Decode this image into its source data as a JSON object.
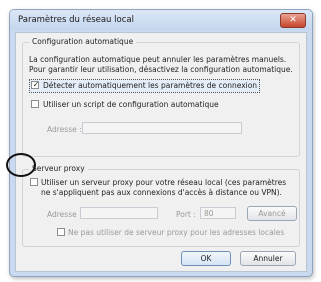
{
  "window": {
    "title": "Paramètres du réseau local",
    "close_glyph": "✕"
  },
  "auto_config": {
    "legend": "Configuration automatique",
    "description_line1": "La configuration automatique peut annuler les paramètres manuels.",
    "description_line2": "Pour garantir leur utilisation, désactivez la configuration automatique.",
    "detect_label": "Détecter automatiquement les paramètres de connexion",
    "detect_checked": true,
    "script_label": "Utiliser un script de configuration automatique",
    "script_checked": false,
    "address_label": "Adresse :",
    "address_value": ""
  },
  "proxy": {
    "legend": "Serveur proxy",
    "use_proxy_label_line1": "Utiliser un serveur proxy pour votre réseau local (ces paramètres",
    "use_proxy_label_line2": "ne s'appliquent pas aux connexions d'accès à distance ou VPN).",
    "use_proxy_checked": false,
    "address_label": "Adresse :",
    "address_value": "",
    "port_label": "Port :",
    "port_value": "80",
    "advanced_label": "Avancé",
    "bypass_label": "Ne pas utiliser de serveur proxy pour les adresses locales",
    "bypass_checked": false
  },
  "buttons": {
    "ok": "OK",
    "cancel": "Annuler"
  },
  "icons": {
    "checkmark": "✓"
  },
  "colors": {
    "title_bar": "#c4d6ee",
    "close_button": "#c7442c",
    "annotation": "#111111"
  }
}
